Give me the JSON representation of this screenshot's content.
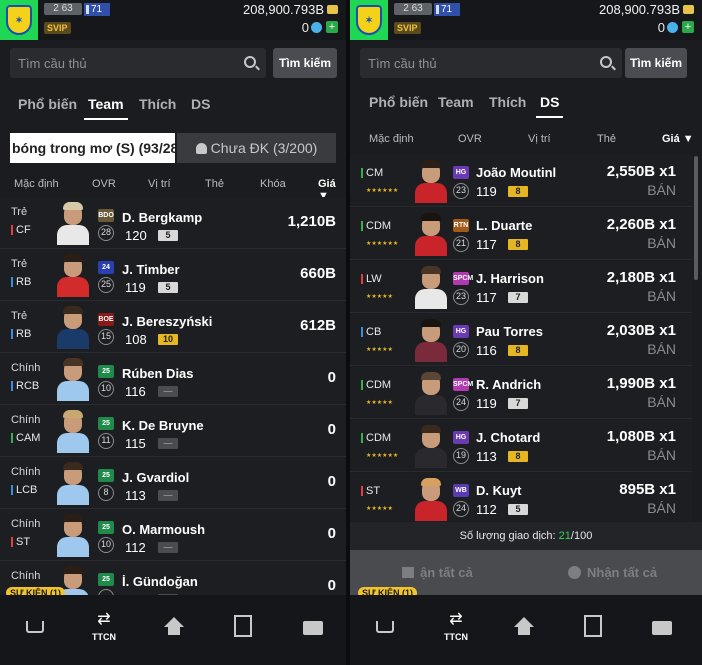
{
  "header": {
    "username": "2 63",
    "level": "71",
    "svip": "SVIP",
    "balance": "208,900.793B",
    "fc_balance": "0",
    "plus": "+"
  },
  "search": {
    "placeholder": "Tìm cầu thủ",
    "button": "Tìm kiếm"
  },
  "tabs": [
    "Phổ biến",
    "Team",
    "Thích",
    "DS"
  ],
  "left": {
    "active_tab": "Team",
    "subtab_active": "bóng trong mơ (S) (93/285)",
    "subtab_other": "Chưa ĐK (3/200)",
    "columns": [
      "Mặc định",
      "OVR",
      "Vị trí",
      "Thẻ",
      "Khóa",
      "Giá ▼"
    ],
    "players": [
      {
        "label": "Trẻ",
        "pos": "CF",
        "pos_color": "#e04040",
        "season": "BDO",
        "season_color": "#6a5a3a",
        "level": "28",
        "name": "D. Bergkamp",
        "ovr": "120",
        "grade": "5",
        "grade_color": "#d8d8d8",
        "price": "1,210B",
        "hair": "#d8c8a8",
        "kit": "#e8e8e8"
      },
      {
        "label": "Trẻ",
        "pos": "RB",
        "pos_color": "#3a8ee0",
        "season": "24",
        "season_color": "#2a3fb0",
        "level": "25",
        "name": "J. Timber",
        "ovr": "119",
        "grade": "5",
        "grade_color": "#d8d8d8",
        "price": "660B",
        "hair": "#2a1e16",
        "kit": "#d32b2b"
      },
      {
        "label": "Trẻ",
        "pos": "RB",
        "pos_color": "#3a8ee0",
        "season": "BOE",
        "season_color": "#8a1a1a",
        "level": "15",
        "name": "J. Bereszyński",
        "ovr": "108",
        "grade": "10",
        "grade_color": "#e6b622",
        "price": "612B",
        "hair": "#3a2a1e",
        "kit": "#1a3a6a"
      },
      {
        "label": "Chính",
        "pos": "RCB",
        "pos_color": "#3a8ee0",
        "season": "25",
        "season_color": "#1f8a4a",
        "level": "10",
        "name": "Rúben Dias",
        "ovr": "116",
        "grade": "—",
        "grade_color": "#4a4c50",
        "price": "0",
        "hair": "#4a3426",
        "kit": "#9ec8ee"
      },
      {
        "label": "Chính",
        "pos": "CAM",
        "pos_color": "#3ab04a",
        "season": "25",
        "season_color": "#1f8a4a",
        "level": "11",
        "name": "K. De Bruyne",
        "ovr": "115",
        "grade": "—",
        "grade_color": "#4a4c50",
        "price": "0",
        "hair": "#c8a870",
        "kit": "#9ec8ee"
      },
      {
        "label": "Chính",
        "pos": "LCB",
        "pos_color": "#3a8ee0",
        "season": "25",
        "season_color": "#1f8a4a",
        "level": "8",
        "name": "J. Gvardiol",
        "ovr": "113",
        "grade": "—",
        "grade_color": "#4a4c50",
        "price": "0",
        "hair": "#3a2a1e",
        "kit": "#9ec8ee"
      },
      {
        "label": "Chính",
        "pos": "ST",
        "pos_color": "#e04040",
        "season": "25",
        "season_color": "#1f8a4a",
        "level": "10",
        "name": "O. Marmoush",
        "ovr": "112",
        "grade": "—",
        "grade_color": "#4a4c50",
        "price": "0",
        "hair": "#2a1e16",
        "kit": "#9ec8ee"
      },
      {
        "label": "Chính",
        "pos": "",
        "pos_color": "#3ab04a",
        "season": "25",
        "season_color": "#1f8a4a",
        "level": "",
        "name": "İ. Gündoğan",
        "ovr": "",
        "grade": "",
        "grade_color": "#4a4c50",
        "price": "0",
        "hair": "#2a1e16",
        "kit": "#9ec8ee"
      }
    ]
  },
  "right": {
    "active_tab": "DS",
    "columns": [
      "Mặc định",
      "OVR",
      "Vị trí",
      "Thẻ",
      "Giá ▼"
    ],
    "players": [
      {
        "pos": "CM",
        "pos_color": "#3ab04a",
        "stars": "★★★★★★",
        "season": "HG",
        "season_color": "#6a3ab0",
        "level": "23",
        "name": "João Moutinl",
        "ovr": "119",
        "grade": "8",
        "grade_color": "#e6b622",
        "price": "2,550B x1",
        "ban": "BÁN",
        "hair": "#2a1e16",
        "kit": "#c8242a"
      },
      {
        "pos": "CDM",
        "pos_color": "#3ab04a",
        "stars": "★★★★★★",
        "season": "RTN",
        "season_color": "#a05a1a",
        "level": "21",
        "name": "L. Duarte",
        "ovr": "117",
        "grade": "8",
        "grade_color": "#e6b622",
        "price": "2,260B x1",
        "ban": "BÁN",
        "hair": "#1a1410",
        "kit": "#c8242a"
      },
      {
        "pos": "LW",
        "pos_color": "#e04040",
        "stars": "★★★★★",
        "season": "SPCM",
        "season_color": "#b03ab0",
        "level": "23",
        "name": "J. Harrison",
        "ovr": "117",
        "grade": "7",
        "grade_color": "#d8d8d8",
        "price": "2,180B x1",
        "ban": "BÁN",
        "hair": "#4a3426",
        "kit": "#e8e8e8"
      },
      {
        "pos": "CB",
        "pos_color": "#3a8ee0",
        "stars": "★★★★★",
        "season": "HG",
        "season_color": "#6a3ab0",
        "level": "20",
        "name": "Pau Torres",
        "ovr": "116",
        "grade": "8",
        "grade_color": "#e6b622",
        "price": "2,030B x1",
        "ban": "BÁN",
        "hair": "#1a1410",
        "kit": "#7a2a3a"
      },
      {
        "pos": "CDM",
        "pos_color": "#3ab04a",
        "stars": "★★★★★",
        "season": "SPCM",
        "season_color": "#b03ab0",
        "level": "24",
        "name": "R. Andrich",
        "ovr": "119",
        "grade": "7",
        "grade_color": "#d8d8d8",
        "price": "1,990B x1",
        "ban": "BÁN",
        "hair": "#5a4636",
        "kit": "#2a2a2e"
      },
      {
        "pos": "CDM",
        "pos_color": "#3ab04a",
        "stars": "★★★★★★",
        "season": "HG",
        "season_color": "#6a3ab0",
        "level": "19",
        "name": "J. Chotard",
        "ovr": "113",
        "grade": "8",
        "grade_color": "#e6b622",
        "price": "1,080B x1",
        "ban": "BÁN",
        "hair": "#3a2a1e",
        "kit": "#2a2a2e"
      },
      {
        "pos": "ST",
        "pos_color": "#e04040",
        "stars": "★★★★★",
        "season": "WB",
        "season_color": "#5a3ab0",
        "level": "24",
        "name": "D. Kuyt",
        "ovr": "112",
        "grade": "5",
        "grade_color": "#d8d8d8",
        "price": "895B x1",
        "ban": "BÁN",
        "hair": "#d8a060",
        "kit": "#c8242a"
      }
    ],
    "trade_label": "Số lượng giao dịch:",
    "trade_used": "21",
    "trade_total": "/100",
    "cancel_all": "ận tất cả",
    "receive_all": "Nhận tất cả"
  },
  "event_badge": "SỰ KIỆN (1)",
  "nav": {
    "ttcn": "TTCN"
  }
}
